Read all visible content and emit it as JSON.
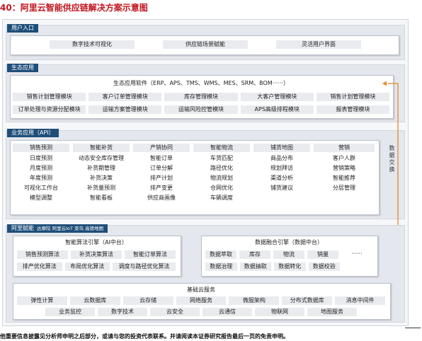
{
  "title": "40：阿里云智能供应链解决方案示意图",
  "user_entry": {
    "label": "用户入口",
    "items": [
      "数字技术可视化",
      "供应链场景赋能",
      "灵活用户界面"
    ]
  },
  "ecosystem": {
    "label": "生态应用",
    "header": "生态应用软件（ERP、APS、TMS、WMS、MES、SRM、BOM······）",
    "row1": [
      "销售计划管理模块",
      "客户订单管理模块",
      "库存管理模块",
      "大客户管理模块",
      "销售计划管理模块"
    ],
    "row2": [
      "订单处理与资源分配模块",
      "运输方案管理模块",
      "运输风险控管模块",
      "APS高级排程模块",
      "报表管理模块"
    ]
  },
  "business": {
    "label": "业务应用（API）",
    "columns": [
      {
        "header": "销售预测",
        "items": [
          "日度预测",
          "月度预测",
          "年度预测",
          "可视化工作台",
          "模型调整"
        ]
      },
      {
        "header": "智能补货",
        "items": [
          "动态安全库存管理",
          "补货期管理",
          "补货决策",
          "补货量预测",
          "智能看板"
        ]
      },
      {
        "header": "产销协同",
        "items": [
          "智能订单",
          "订单分解",
          "排产计划",
          "排产变更",
          "供应商画像"
        ]
      },
      {
        "header": "智能物流",
        "items": [
          "车货匹配",
          "路径优化",
          "物流规划",
          "仓网优化",
          "车辆调度"
        ]
      },
      {
        "header": "铺货地图",
        "items": [
          "商品分布",
          "规划拜访",
          "渠道分析",
          "铺货建议"
        ]
      },
      {
        "header": "营销",
        "items": [
          "客户人群",
          "营销策略",
          "智能推荐",
          "分层管理"
        ]
      }
    ]
  },
  "data_exchange": "数据交换",
  "empower": {
    "label": "阿里赋能",
    "sub": "达摩院 阿里云IoT 菜鸟 高德地图"
  },
  "algorithm": {
    "header": "智能算法引擎（AI中台）",
    "row1": [
      "销售预测算法",
      "补货决策算法",
      "智能订单算法"
    ],
    "row2": [
      "排产优化算法",
      "布局优化算法",
      "调度与路径优化算法"
    ]
  },
  "data_engine": {
    "header": "数据融合引擎（数据中台）",
    "row1": [
      "数据萃取",
      "库存",
      "物流",
      "销量",
      "······"
    ],
    "row2": [
      "数据治理",
      "数据抽取",
      "数据转化",
      "数据校验"
    ]
  },
  "cloud": {
    "header": "基础云服务",
    "row1": [
      "弹性计算",
      "云数据库",
      "云存储",
      "网络服务",
      "微服架构",
      "分布式数据库",
      "消息中间件"
    ],
    "row2": [
      "业务监控",
      "数字技术",
      "云安全",
      "云通信",
      "物联网",
      "地图服务"
    ]
  },
  "footer": "他重要信息披露见分析师申明之后部分，或请与您的投资代表联系。并请阅读本证券研究报告最后一页的免责申明。"
}
